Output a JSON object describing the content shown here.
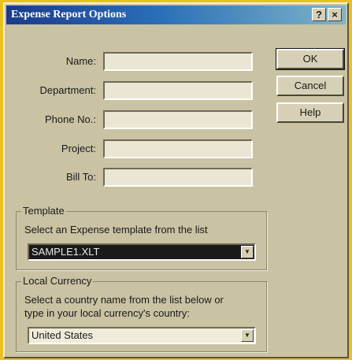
{
  "dialog": {
    "title": "Expense Report Options",
    "help_glyph": "?",
    "close_glyph": "×"
  },
  "fields": {
    "name_label": "Name:",
    "department_label": "Department:",
    "phone_label": "Phone No.:",
    "project_label": "Project:",
    "bill_to_label": "Bill To:",
    "name_value": "",
    "department_value": "",
    "phone_value": "",
    "project_value": "",
    "bill_to_value": ""
  },
  "template": {
    "group_label": "Template",
    "instruction": "Select an Expense template from the list",
    "selected": "SAMPLE1.XLT"
  },
  "currency": {
    "group_label": "Local Currency",
    "instruction_line1": "Select a country name from the list below or",
    "instruction_line2": "type in your local currency's country:",
    "selected": "United States"
  },
  "buttons": {
    "ok": "OK",
    "cancel": "Cancel",
    "help": "Help"
  },
  "icons": {
    "dropdown_arrow": "chevron-down-icon"
  },
  "colors": {
    "background": "#e8c21e",
    "dialog": "#c9c2a3",
    "title_start": "#1b3a8c",
    "title_end": "#7fb4c8",
    "selected_field": "#1a1a1a"
  }
}
